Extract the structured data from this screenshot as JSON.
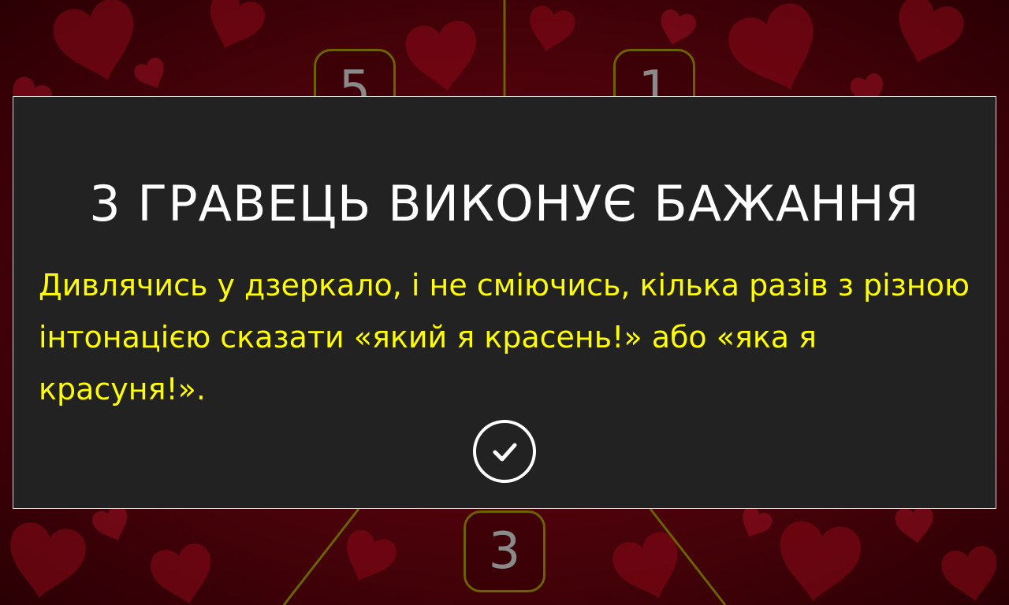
{
  "board": {
    "sectors": [
      {
        "number": "5"
      },
      {
        "number": "1"
      },
      {
        "number": "3"
      }
    ]
  },
  "dialog": {
    "title": "3 ГРАВЕЦЬ ВИКОНУЄ БАЖАННЯ",
    "text": "Дивлячись у дзеркало, і не сміючись, кілька разів з різною інтонацією сказати «який я красень!» або «яка я красуня!».",
    "confirm_icon": "check-circle-icon"
  },
  "colors": {
    "background": "#5a030c",
    "dialog_bg": "#222222",
    "title": "#ffffff",
    "text": "#ffff00",
    "sector_border": "#6b6200",
    "sector_text": "#8a8a8a"
  }
}
